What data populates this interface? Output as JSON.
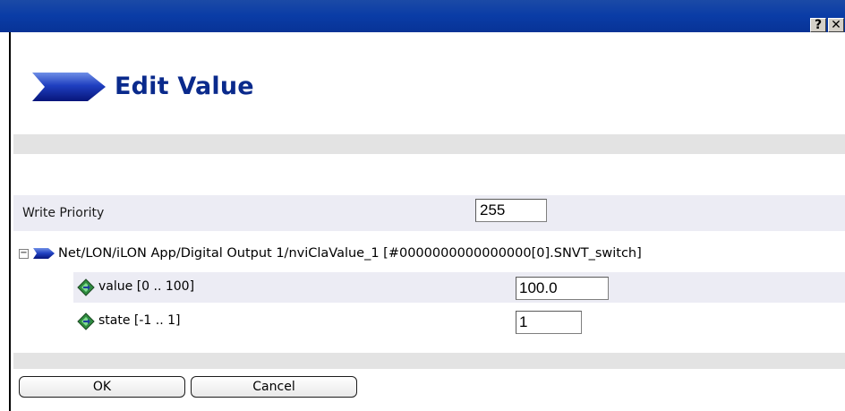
{
  "window": {
    "help_button": "?",
    "close_button": "✕"
  },
  "header": {
    "title": "Edit Value"
  },
  "write_priority": {
    "label": "Write Priority",
    "value": "255"
  },
  "tree": {
    "toggle_symbol": "−",
    "node_path": "Net/LON/iLON App/Digital Output 1/nviClaValue_1 [#0000000000000000[0].SNVT_switch]",
    "fields": [
      {
        "label": "value [0 .. 100]",
        "value": "100.0"
      },
      {
        "label": "state [-1 .. 1]",
        "value": "1"
      }
    ]
  },
  "buttons": {
    "ok": "OK",
    "cancel": "Cancel"
  },
  "colors": {
    "titlebar": "#0a3ca6",
    "title_text": "#0a2a8c",
    "row_highlight": "#ececf4",
    "band": "#e3e3e3",
    "diamond_icon": "#2e8b3e"
  }
}
